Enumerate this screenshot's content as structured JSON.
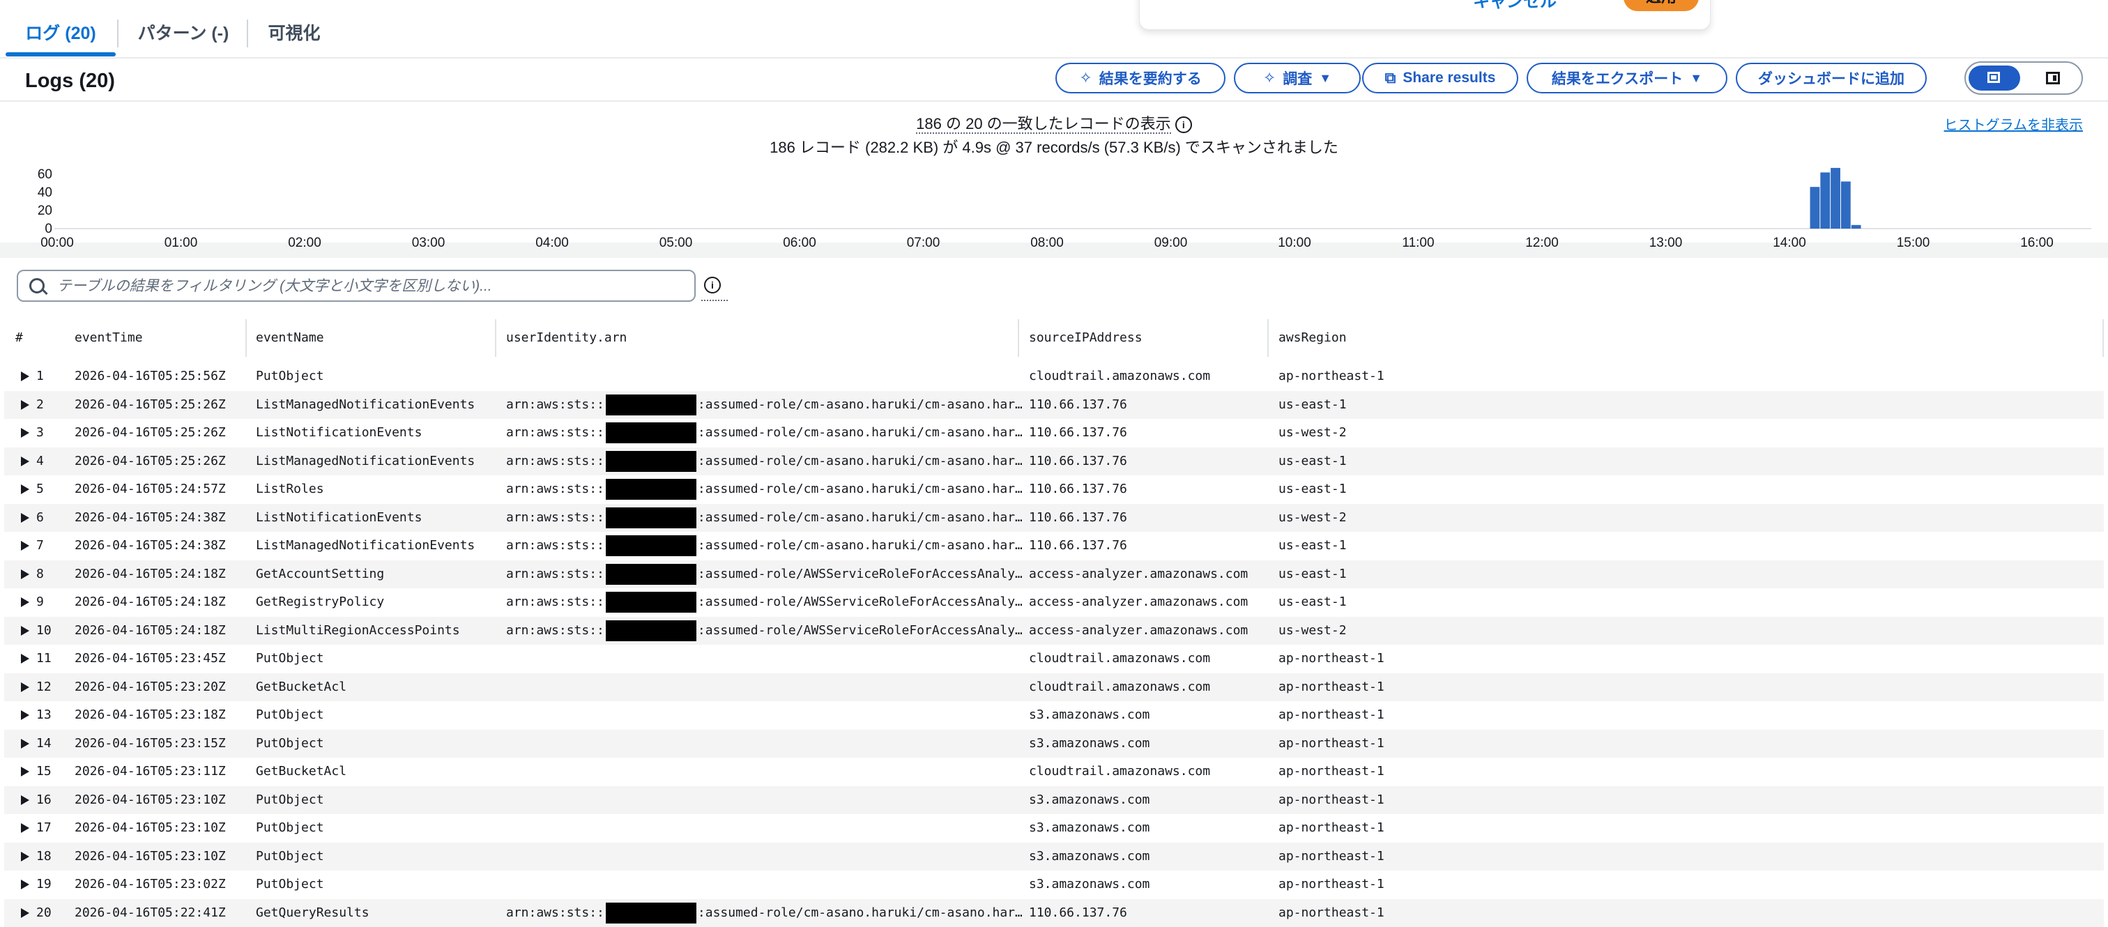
{
  "tabs": [
    {
      "label": "ログ (20)"
    },
    {
      "label": "パターン (-)"
    },
    {
      "label": "可視化"
    }
  ],
  "modal": {
    "cancel_label": "キャンセル",
    "apply_label": "適用"
  },
  "header": {
    "title": "Logs (20)",
    "buttons": {
      "summarize": "結果を要約する",
      "investigate": "調査",
      "share": "Share results",
      "export": "結果をエクスポート",
      "dashboard": "ダッシュボードに追加"
    }
  },
  "histogram": {
    "summary_line1": "186 の 20 の一致したレコードの表示",
    "summary_line2": "186 レコード (282.2 KB) が 4.9s @ 37 records/s (57.3 KB/s) でスキャンされました",
    "hide_link": "ヒストグラムを非表示"
  },
  "chart_data": {
    "type": "bar",
    "y_ticks": [
      "60",
      "40",
      "20",
      "0"
    ],
    "ylim": [
      0,
      70
    ],
    "x_ticks": [
      "00:00",
      "01:00",
      "02:00",
      "03:00",
      "04:00",
      "05:00",
      "06:00",
      "07:00",
      "08:00",
      "09:00",
      "10:00",
      "11:00",
      "12:00",
      "13:00",
      "14:00",
      "15:00",
      "16:00"
    ],
    "bars": [
      {
        "x": "14:10",
        "value": 46
      },
      {
        "x": "14:15",
        "value": 62
      },
      {
        "x": "14:20",
        "value": 67
      },
      {
        "x": "14:25",
        "value": 52
      },
      {
        "x": "14:30",
        "value": 4
      }
    ],
    "bar_color": "#2f6bc1"
  },
  "filter": {
    "placeholder": "テーブルの結果をフィルタリング (大文字と小文字を区別しない)..."
  },
  "table": {
    "columns": [
      "#",
      "eventTime",
      "eventName",
      "userIdentity.arn",
      "sourceIPAddress",
      "awsRegion"
    ],
    "rows": [
      {
        "n": "1",
        "time": "2026-04-16T05:25:56Z",
        "name": "PutObject",
        "arn_pre": "",
        "arn_post": "",
        "ip": "cloudtrail.amazonaws.com",
        "region": "ap-northeast-1"
      },
      {
        "n": "2",
        "time": "2026-04-16T05:25:26Z",
        "name": "ListManagedNotificationEvents",
        "arn_pre": "arn:aws:sts::",
        "arn_post": ":assumed-role/cm-asano.haruki/cm-asano.har…",
        "ip": "110.66.137.76",
        "region": "us-east-1"
      },
      {
        "n": "3",
        "time": "2026-04-16T05:25:26Z",
        "name": "ListNotificationEvents",
        "arn_pre": "arn:aws:sts::",
        "arn_post": ":assumed-role/cm-asano.haruki/cm-asano.har…",
        "ip": "110.66.137.76",
        "region": "us-west-2"
      },
      {
        "n": "4",
        "time": "2026-04-16T05:25:26Z",
        "name": "ListManagedNotificationEvents",
        "arn_pre": "arn:aws:sts::",
        "arn_post": ":assumed-role/cm-asano.haruki/cm-asano.har…",
        "ip": "110.66.137.76",
        "region": "us-east-1"
      },
      {
        "n": "5",
        "time": "2026-04-16T05:24:57Z",
        "name": "ListRoles",
        "arn_pre": "arn:aws:sts::",
        "arn_post": ":assumed-role/cm-asano.haruki/cm-asano.har…",
        "ip": "110.66.137.76",
        "region": "us-east-1"
      },
      {
        "n": "6",
        "time": "2026-04-16T05:24:38Z",
        "name": "ListNotificationEvents",
        "arn_pre": "arn:aws:sts::",
        "arn_post": ":assumed-role/cm-asano.haruki/cm-asano.har…",
        "ip": "110.66.137.76",
        "region": "us-west-2"
      },
      {
        "n": "7",
        "time": "2026-04-16T05:24:38Z",
        "name": "ListManagedNotificationEvents",
        "arn_pre": "arn:aws:sts::",
        "arn_post": ":assumed-role/cm-asano.haruki/cm-asano.har…",
        "ip": "110.66.137.76",
        "region": "us-east-1"
      },
      {
        "n": "8",
        "time": "2026-04-16T05:24:18Z",
        "name": "GetAccountSetting",
        "arn_pre": "arn:aws:sts::",
        "arn_post": ":assumed-role/AWSServiceRoleForAccessAnaly…",
        "ip": "access-analyzer.amazonaws.com",
        "region": "us-east-1"
      },
      {
        "n": "9",
        "time": "2026-04-16T05:24:18Z",
        "name": "GetRegistryPolicy",
        "arn_pre": "arn:aws:sts::",
        "arn_post": ":assumed-role/AWSServiceRoleForAccessAnaly…",
        "ip": "access-analyzer.amazonaws.com",
        "region": "us-east-1"
      },
      {
        "n": "10",
        "time": "2026-04-16T05:24:18Z",
        "name": "ListMultiRegionAccessPoints",
        "arn_pre": "arn:aws:sts::",
        "arn_post": ":assumed-role/AWSServiceRoleForAccessAnaly…",
        "ip": "access-analyzer.amazonaws.com",
        "region": "us-west-2"
      },
      {
        "n": "11",
        "time": "2026-04-16T05:23:45Z",
        "name": "PutObject",
        "arn_pre": "",
        "arn_post": "",
        "ip": "cloudtrail.amazonaws.com",
        "region": "ap-northeast-1"
      },
      {
        "n": "12",
        "time": "2026-04-16T05:23:20Z",
        "name": "GetBucketAcl",
        "arn_pre": "",
        "arn_post": "",
        "ip": "cloudtrail.amazonaws.com",
        "region": "ap-northeast-1"
      },
      {
        "n": "13",
        "time": "2026-04-16T05:23:18Z",
        "name": "PutObject",
        "arn_pre": "",
        "arn_post": "",
        "ip": "s3.amazonaws.com",
        "region": "ap-northeast-1"
      },
      {
        "n": "14",
        "time": "2026-04-16T05:23:15Z",
        "name": "PutObject",
        "arn_pre": "",
        "arn_post": "",
        "ip": "s3.amazonaws.com",
        "region": "ap-northeast-1"
      },
      {
        "n": "15",
        "time": "2026-04-16T05:23:11Z",
        "name": "GetBucketAcl",
        "arn_pre": "",
        "arn_post": "",
        "ip": "cloudtrail.amazonaws.com",
        "region": "ap-northeast-1"
      },
      {
        "n": "16",
        "time": "2026-04-16T05:23:10Z",
        "name": "PutObject",
        "arn_pre": "",
        "arn_post": "",
        "ip": "s3.amazonaws.com",
        "region": "ap-northeast-1"
      },
      {
        "n": "17",
        "time": "2026-04-16T05:23:10Z",
        "name": "PutObject",
        "arn_pre": "",
        "arn_post": "",
        "ip": "s3.amazonaws.com",
        "region": "ap-northeast-1"
      },
      {
        "n": "18",
        "time": "2026-04-16T05:23:10Z",
        "name": "PutObject",
        "arn_pre": "",
        "arn_post": "",
        "ip": "s3.amazonaws.com",
        "region": "ap-northeast-1"
      },
      {
        "n": "19",
        "time": "2026-04-16T05:23:02Z",
        "name": "PutObject",
        "arn_pre": "",
        "arn_post": "",
        "ip": "s3.amazonaws.com",
        "region": "ap-northeast-1"
      },
      {
        "n": "20",
        "time": "2026-04-16T05:22:41Z",
        "name": "GetQueryResults",
        "arn_pre": "arn:aws:sts::",
        "arn_post": ":assumed-role/cm-asano.haruki/cm-asano.har…",
        "ip": "110.66.137.76",
        "region": "ap-northeast-1"
      }
    ]
  }
}
